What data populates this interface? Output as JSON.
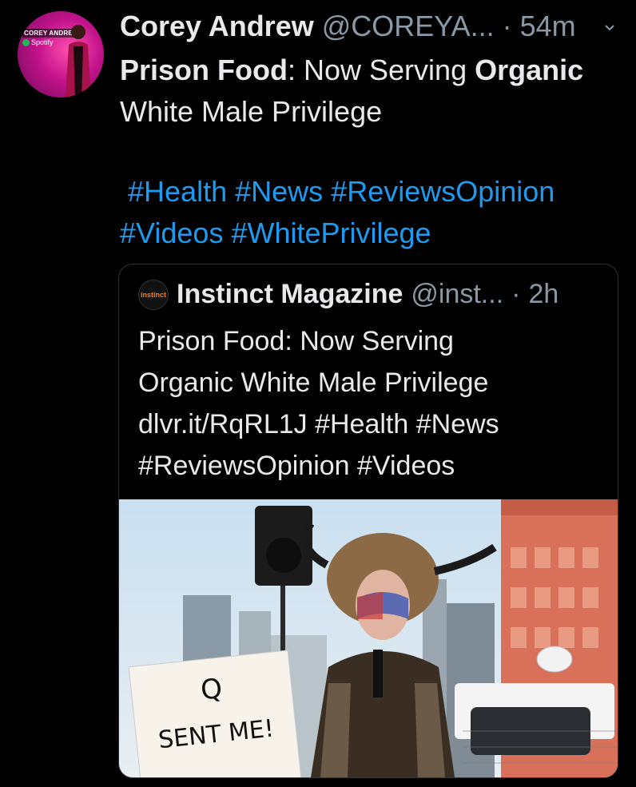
{
  "tweet": {
    "author_name": "Corey Andrew",
    "author_handle": "@COREYA...",
    "separator": "·",
    "time": "54m",
    "avatar_lines": [
      "COREY ANDREW",
      "Spotify"
    ],
    "text_bold_1": "Prison Food",
    "text_part_2": ": Now Serving ",
    "text_bold_3": "Organic",
    "text_part_4": "White Male Privilege",
    "hashtags": [
      "#Health",
      "#News",
      "#ReviewsOpinion",
      "#Videos",
      "#WhitePrivilege"
    ]
  },
  "quoted": {
    "avatar_label": "instinct",
    "author_name": "Instinct Magazine",
    "author_handle": "@inst...",
    "separator": "·",
    "time": "2h",
    "text_lines": [
      "Prison Food: Now Serving",
      "Organic White Male Privilege",
      "dlvr.it/RqRL1J #Health #News",
      "#ReviewsOpinion #Videos"
    ],
    "media_sign_lines": [
      "Q",
      "SENT ME!"
    ]
  },
  "colors": {
    "background": "#000000",
    "text": "#e7e9ea",
    "muted": "#8b98a5",
    "link": "#1d9bf0"
  }
}
